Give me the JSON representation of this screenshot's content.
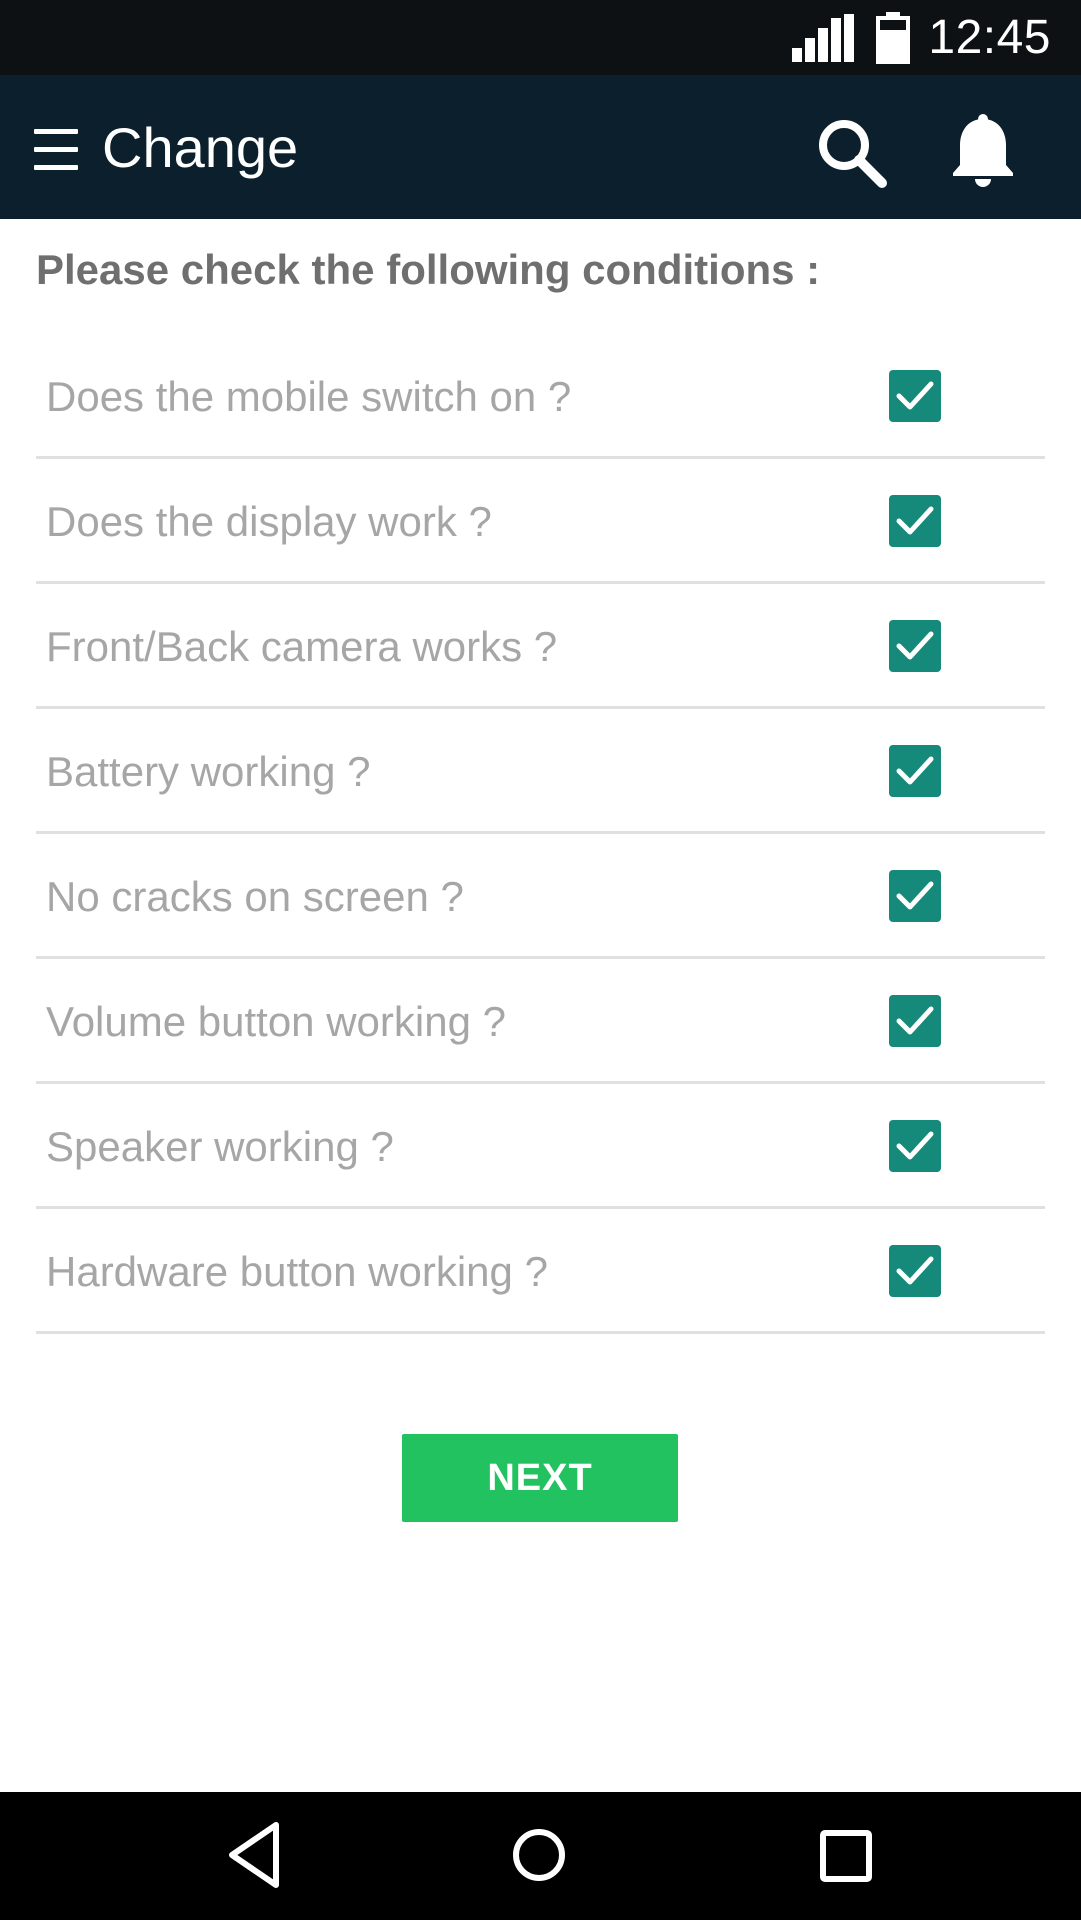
{
  "status_bar": {
    "time": "12:45",
    "signal_icon": "signal-icon",
    "battery_icon": "battery-icon"
  },
  "app_bar": {
    "title": "Change",
    "menu_icon": "menu-icon",
    "search_icon": "search-icon",
    "notification_icon": "bell-icon",
    "background_color": "#0b1f2d"
  },
  "content": {
    "heading": "Please check the following conditions :",
    "conditions": [
      {
        "label": "Does the mobile switch on ?",
        "checked": true
      },
      {
        "label": "Does the display work ?",
        "checked": true
      },
      {
        "label": "Front/Back camera works ?",
        "checked": true
      },
      {
        "label": "Battery working ?",
        "checked": true
      },
      {
        "label": "No cracks on screen ?",
        "checked": true
      },
      {
        "label": "Volume button working ?",
        "checked": true
      },
      {
        "label": "Speaker working ?",
        "checked": true
      },
      {
        "label": "Hardware button working ?",
        "checked": true
      }
    ],
    "checkbox_color": "#15897a",
    "next_label": "NEXT",
    "next_color": "#22c260"
  },
  "nav_bar": {
    "back_icon": "back-triangle-icon",
    "home_icon": "home-circle-icon",
    "recents_icon": "recents-square-icon"
  }
}
